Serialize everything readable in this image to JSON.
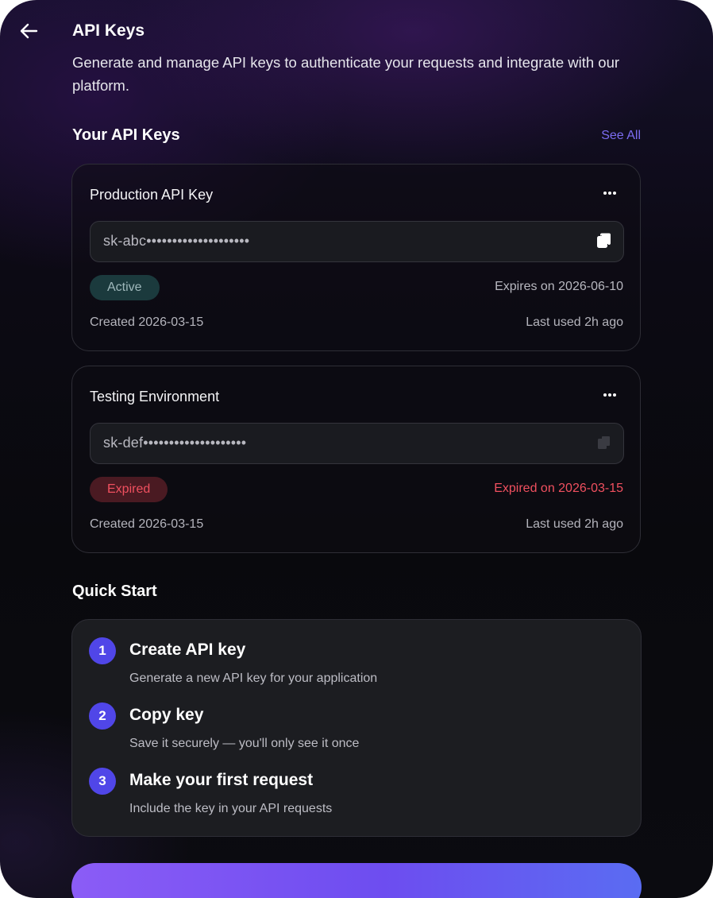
{
  "header": {
    "title": "API Keys",
    "subtitle": "Generate and manage API keys to authenticate your requests and integrate with our platform."
  },
  "keys_section": {
    "title": "Your API Keys",
    "see_all": "See All",
    "keys": [
      {
        "name": "Production API Key",
        "value": "sk-abc••••••••••••••••••••",
        "status": "Active",
        "expiry": "Expires on 2026-06-10",
        "created": "Created 2026-03-15",
        "last_used": "Last used 2h ago"
      },
      {
        "name": "Testing Environment",
        "value": "sk-def••••••••••••••••••••",
        "status": "Expired",
        "expiry": "Expired on 2026-03-15",
        "created": "Created 2026-03-15",
        "last_used": "Last used 2h ago"
      }
    ]
  },
  "quick_start": {
    "title": "Quick Start",
    "steps": [
      {
        "number": "1",
        "title": "Create API key",
        "description": "Generate a new API key for your application"
      },
      {
        "number": "2",
        "title": "Copy key",
        "description": "Save it securely — you'll only see it once"
      },
      {
        "number": "3",
        "title": "Make your first request",
        "description": "Include the key in your API requests"
      }
    ]
  },
  "colors": {
    "accent": "#5046e8",
    "link": "#7b6cf0",
    "active_badge_bg": "#1b3a3d",
    "expired": "#f0505f"
  },
  "icons": {
    "back": "arrow-left-icon",
    "more": "more-horizontal-icon",
    "copy": "copy-icon"
  }
}
